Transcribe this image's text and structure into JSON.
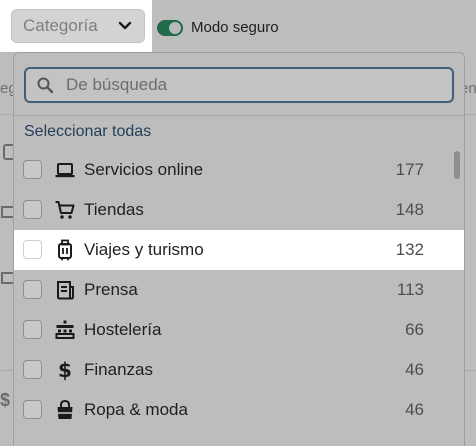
{
  "toolbar": {
    "category_button_label": "Categoría",
    "safe_mode_label": "Modo seguro",
    "safe_mode_on": true
  },
  "background": {
    "left_fragment": "eg",
    "right_fragment": "en"
  },
  "dropdown": {
    "search_placeholder": "De búsqueda",
    "select_all_label": "Seleccionar todas",
    "items": [
      {
        "label": "Servicios online",
        "count": "177",
        "icon": "laptop-icon",
        "checked": false
      },
      {
        "label": "Tiendas",
        "count": "148",
        "icon": "cart-icon",
        "checked": false
      },
      {
        "label": "Viajes y turismo",
        "count": "132",
        "icon": "luggage-icon",
        "checked": false,
        "highlighted": true
      },
      {
        "label": "Prensa",
        "count": "113",
        "icon": "newspaper-icon",
        "checked": false
      },
      {
        "label": "Hostelería",
        "count": "66",
        "icon": "restaurant-icon",
        "checked": false
      },
      {
        "label": "Finanzas",
        "count": "46",
        "icon": "dollar-icon",
        "checked": false
      },
      {
        "label": "Ropa & moda",
        "count": "46",
        "icon": "shopping-bag-icon",
        "checked": false
      }
    ]
  },
  "colors": {
    "accent": "#1f6b4c",
    "search_border": "#3f5f7a",
    "select_all_text": "#243f58"
  }
}
